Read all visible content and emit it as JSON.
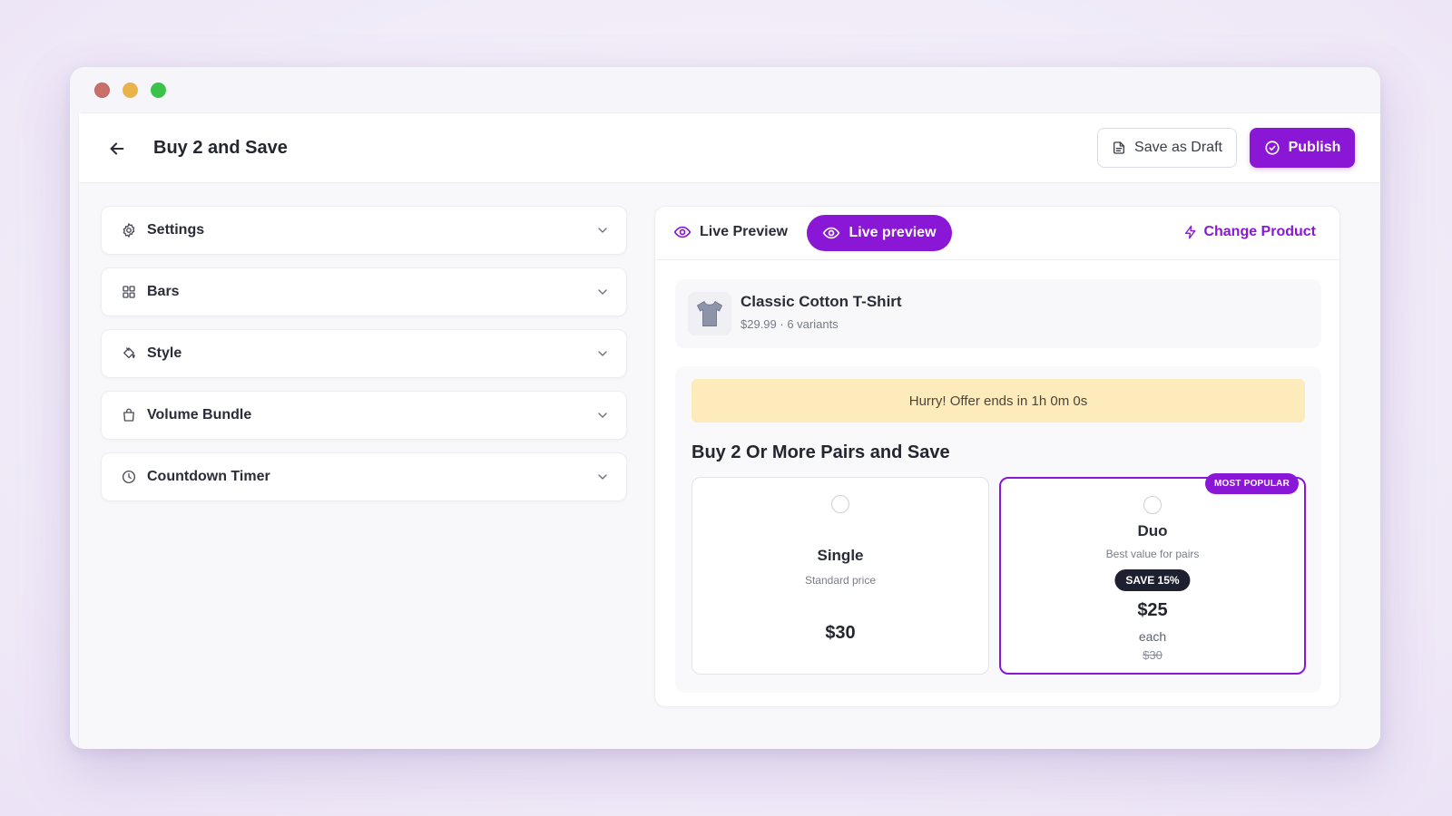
{
  "header": {
    "title": "Buy 2 and Save",
    "save_draft_label": "Save as Draft",
    "publish_label": "Publish"
  },
  "sidebar": {
    "items": [
      {
        "label": "Settings",
        "icon": "gear-icon"
      },
      {
        "label": "Bars",
        "icon": "grid-icon"
      },
      {
        "label": "Style",
        "icon": "paint-bucket-icon"
      },
      {
        "label": "Volume Bundle",
        "icon": "shopping-bag-icon"
      },
      {
        "label": "Countdown Timer",
        "icon": "clock-icon"
      }
    ]
  },
  "preview": {
    "tab_label": "Live Preview",
    "active_tab_label": "Live preview",
    "change_product_label": "Change Product",
    "product": {
      "name": "Classic Cotton T-Shirt",
      "meta": "$29.99 · 6 variants"
    },
    "timer_text": "Hurry! Offer ends in 1h 0m 0s",
    "offer_title": "Buy 2 Or More Pairs and Save",
    "tiers": [
      {
        "name": "Single",
        "subtitle": "Standard price",
        "price": "$30"
      },
      {
        "name": "Duo",
        "subtitle": "Best value for pairs",
        "badge": "SAVE 15%",
        "price": "$25",
        "unit": "each",
        "old_price": "$30",
        "tag": "MOST POPULAR"
      }
    ]
  },
  "colors": {
    "accent": "#8a17d6",
    "timer_bg": "#fdebbc",
    "badge_dark": "#1e2030"
  }
}
